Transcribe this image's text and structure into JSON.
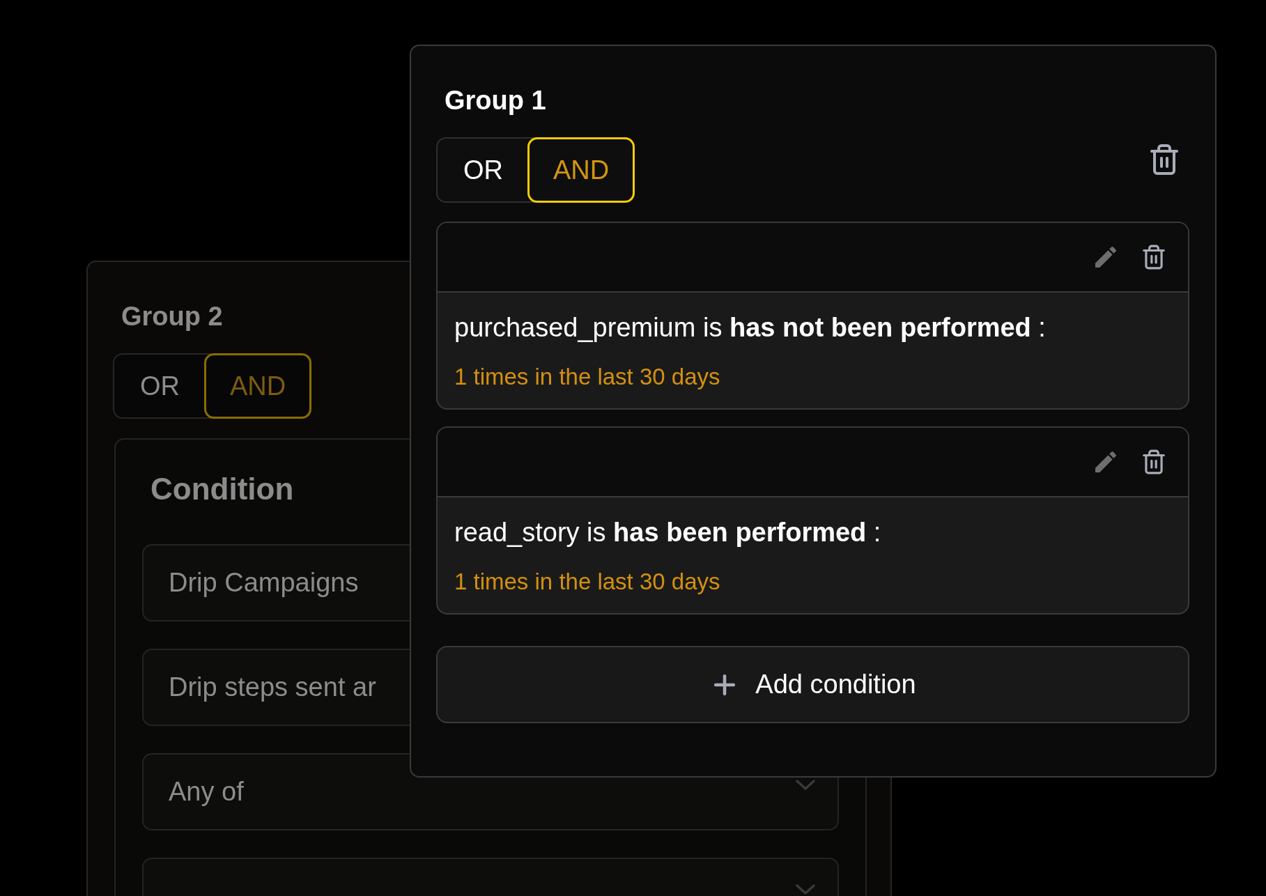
{
  "back_group": {
    "title": "Group 2",
    "operators": [
      {
        "label": "OR",
        "selected": false
      },
      {
        "label": "AND",
        "selected": true
      }
    ],
    "condition_editor": {
      "title": "Condition",
      "fields": [
        {
          "kind": "text",
          "value": "Drip Campaigns"
        },
        {
          "kind": "text",
          "value": "Drip steps sent ar"
        },
        {
          "kind": "dropdown",
          "value": "Any of"
        },
        {
          "kind": "dropdown"
        }
      ]
    }
  },
  "front_group": {
    "title": "Group 1",
    "operators": [
      {
        "label": "OR",
        "selected": false
      },
      {
        "label": "AND",
        "selected": true
      }
    ],
    "conditions": [
      {
        "summary": "purchased_premium is **has not been performed** :",
        "detail": "1 times in the last 30 days"
      },
      {
        "summary": "read_story is **has been performed** :",
        "detail": "1 times in the last 30 days"
      }
    ],
    "add_button": {
      "label": "Add condition"
    }
  }
}
